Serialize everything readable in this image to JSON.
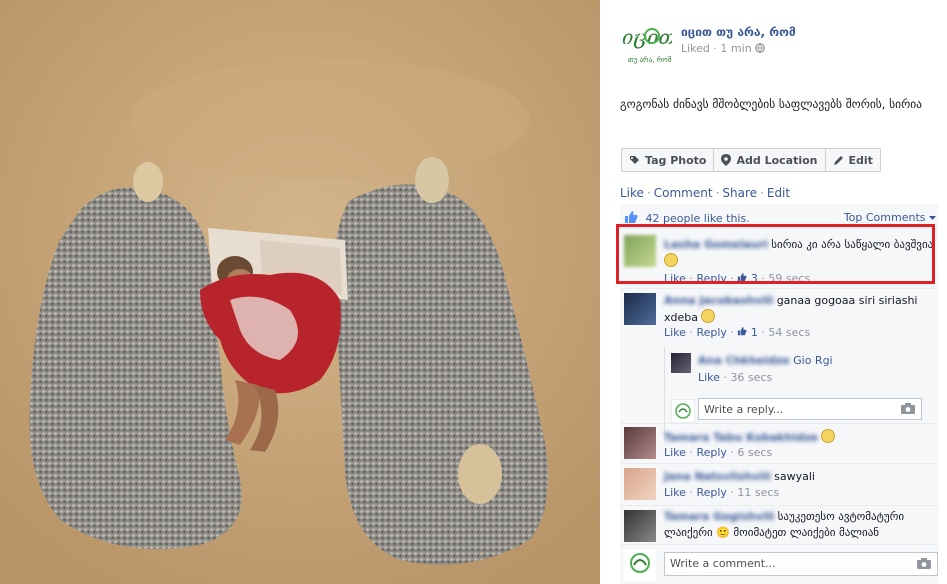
{
  "page": {
    "name": "იცით თუ არა, რომ",
    "status": "Liked",
    "time": "1 min",
    "logo_text": "იცით",
    "logo_subtext": "თუ არა, რომ"
  },
  "post": {
    "caption": "გოგონას ძინავს მშობლების საფლავებს შორის, სირია"
  },
  "photo_buttons": {
    "tag_photo": "Tag Photo",
    "add_location": "Add Location",
    "edit": "Edit"
  },
  "actions": {
    "like": "Like",
    "comment": "Comment",
    "share": "Share",
    "edit": "Edit",
    "dot": "·"
  },
  "likes": {
    "summary": "42 people like this.",
    "top_comments": "Top Comments"
  },
  "comments": [
    {
      "name": "Lasha Gomelauri",
      "text": "სირია კი არა საწყალი ბავშვია",
      "like": "Like",
      "reply": "Reply",
      "likes": "3",
      "time": "59 secs"
    },
    {
      "name": "Anna Jacobashvili",
      "text": "ganaa gogoaa siri siriashi xdeba",
      "like": "Like",
      "reply": "Reply",
      "likes": "1",
      "time": "54 secs"
    },
    {
      "name": "Tamara Tabu Kobakhidze",
      "text": "",
      "like": "Like",
      "reply": "Reply",
      "time": "6 secs"
    },
    {
      "name": "Jana Natsvlishvili",
      "text": "sawyali",
      "like": "Like",
      "reply": "Reply",
      "time": "11 secs"
    },
    {
      "name": "Tamara Gogishvili",
      "text": "საუკეთესო ავტომატური ლაიქერი 🙂 მოიმატეთ ლაიქები მალიან",
      "like": "Like",
      "reply": "Reply",
      "time": ""
    }
  ],
  "reply": {
    "name": "Ana Chkheidze",
    "text": "Gio Rgi",
    "like": "Like",
    "time": "36 secs",
    "placeholder": "Write a reply..."
  },
  "composer": {
    "placeholder": "Write a comment..."
  }
}
